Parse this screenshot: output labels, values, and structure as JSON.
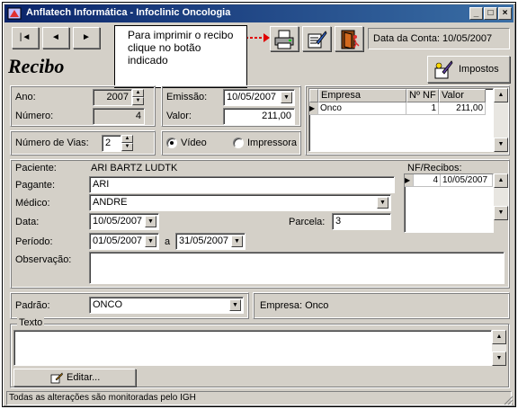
{
  "window": {
    "title": "Anflatech Informática - Infoclinic Oncologia",
    "controls": [
      "_",
      "□",
      "×"
    ]
  },
  "toolbar": {
    "nav": [
      "|◄",
      "◄",
      "►"
    ],
    "tooltip": "Para imprimir o recibo clique no botão indicado",
    "icons": [
      "printer-icon",
      "edit-form-icon",
      "exit-door-icon"
    ],
    "data_conta": "Data da Conta:  10/05/2007"
  },
  "page": {
    "title": "Recibo",
    "impostos_label": "Impostos"
  },
  "form": {
    "ano_label": "Ano:",
    "ano": "2007",
    "numero_label": "Número:",
    "numero": "4",
    "emissao_label": "Emissão:",
    "emissao": "10/05/2007",
    "valor_label": "Valor:",
    "valor": "211,00",
    "vias_label": "Número de Vias:",
    "vias": "2",
    "radio_video": "Vídeo",
    "radio_impressora": "Impressora",
    "paciente_label": "Paciente:",
    "paciente": "ARI BARTZ LUDTK",
    "pagante_label": "Pagante:",
    "pagante": "ARI",
    "medico_label": "Médico:",
    "medico": "ANDRE",
    "data_label": "Data:",
    "data": "10/05/2007",
    "parcela_label": "Parcela:",
    "parcela": "3",
    "periodo_label": "Período:",
    "periodo_ini": "01/05/2007",
    "periodo_a": "a",
    "periodo_fim": "31/05/2007",
    "observacao_label": "Observação:",
    "padrao_label": "Padrão:",
    "padrao": "ONCO",
    "empresa_info": "Empresa: Onco",
    "texto_label": "Texto",
    "editar_label": "Editar..."
  },
  "empresa_grid": {
    "headers": [
      "Empresa",
      "Nº NF",
      "Valor"
    ],
    "rows": [
      {
        "empresa": "Onco",
        "nf": "1",
        "valor": "211,00"
      }
    ]
  },
  "nf_grid": {
    "label": "NF/Recibos:",
    "rows": [
      {
        "num": "4",
        "data": "10/05/2007"
      }
    ]
  },
  "status": {
    "text": "Todas as alterações são monitoradas pelo IGH"
  }
}
